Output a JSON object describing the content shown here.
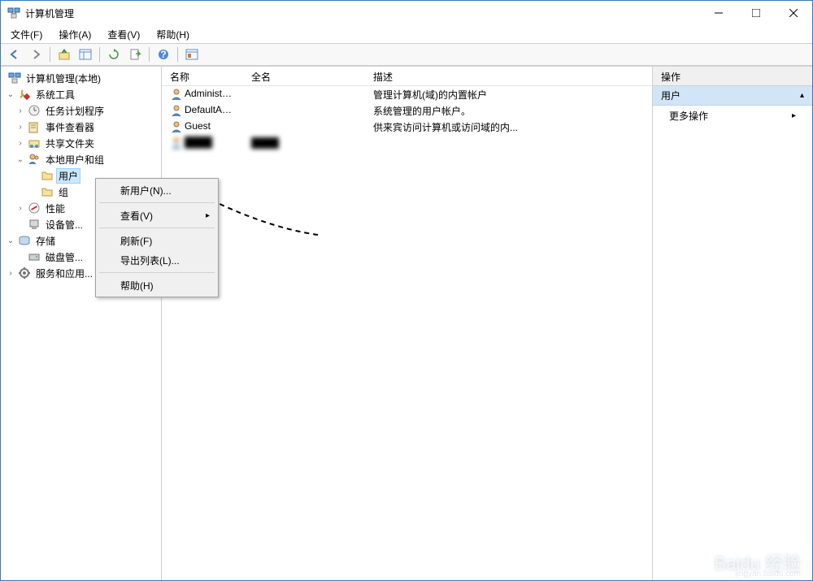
{
  "window": {
    "title": "计算机管理"
  },
  "menu": {
    "file": "文件(F)",
    "action": "操作(A)",
    "view": "查看(V)",
    "help": "帮助(H)"
  },
  "tree": {
    "root": "计算机管理(本地)",
    "system_tools": "系统工具",
    "task_scheduler": "任务计划程序",
    "event_viewer": "事件查看器",
    "shared_folders": "共享文件夹",
    "local_users_groups": "本地用户和组",
    "users": "用户",
    "groups": "组",
    "performance": "性能",
    "device_manager": "设备管...",
    "storage": "存储",
    "disk_mgmt": "磁盘管...",
    "services": "服务和应用..."
  },
  "list": {
    "header_name": "名称",
    "header_fullname": "全名",
    "header_desc": "描述",
    "rows": [
      {
        "name": "Administrat...",
        "fullname": "",
        "desc": "管理计算机(域)的内置帐户"
      },
      {
        "name": "DefaultAcc...",
        "fullname": "",
        "desc": "系统管理的用户帐户。"
      },
      {
        "name": "Guest",
        "fullname": "",
        "desc": "供来宾访问计算机或访问域的内..."
      },
      {
        "name": "████",
        "fullname": "████",
        "desc": "",
        "blurred": true
      }
    ]
  },
  "actions": {
    "header": "操作",
    "group": "用户",
    "more": "更多操作"
  },
  "context": {
    "new_user": "新用户(N)...",
    "view": "查看(V)",
    "refresh": "刷新(F)",
    "export": "导出列表(L)...",
    "help": "帮助(H)"
  },
  "watermark": {
    "main": "Baidu 经验",
    "sub": "jingyan.baidu.com"
  }
}
